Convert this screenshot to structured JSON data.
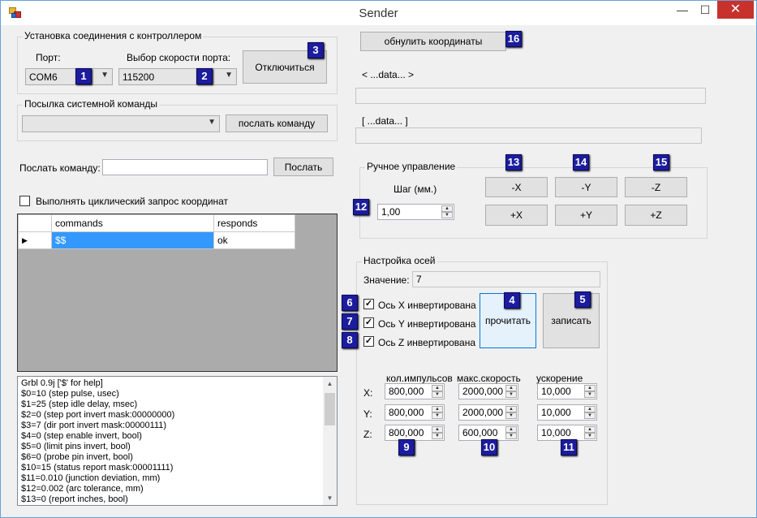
{
  "window": {
    "title": "Sender",
    "minimize": "—",
    "maximize": "☐",
    "close": "✕"
  },
  "connection": {
    "group_title": "Установка соединения с контроллером",
    "port_label": "Порт:",
    "port_value": "COM6",
    "speed_label": "Выбор скорости порта:",
    "speed_value": "115200",
    "disconnect_label": "Отключиться"
  },
  "system_command": {
    "group_title": "Посылка системной команды",
    "combo_value": "",
    "send_label": "послать команду"
  },
  "send_command": {
    "label": "Послать команду:",
    "value": "",
    "button": "Послать"
  },
  "cyclic": {
    "label": "Выполнять циклический запрос координат",
    "checked": false
  },
  "grid": {
    "headers": [
      "commands",
      "responds"
    ],
    "rows": [
      {
        "command": "$$",
        "respond": "ok"
      }
    ]
  },
  "log_lines": [
    "Grbl 0.9j ['$' for help]",
    "$0=10 (step pulse, usec)",
    "$1=25 (step idle delay, msec)",
    "$2=0 (step port invert mask:00000000)",
    "$3=7 (dir port invert mask:00000111)",
    "$4=0 (step enable invert, bool)",
    "$5=0 (limit pins invert, bool)",
    "$6=0 (probe pin invert, bool)",
    "$10=15 (status report mask:00001111)",
    "$11=0.010 (junction deviation, mm)",
    "$12=0.002 (arc tolerance, mm)",
    "$13=0 (report inches, bool)"
  ],
  "reset_coords": "обнулить координаты",
  "data_angle_label": "< ...data... >",
  "data_angle_value": "",
  "data_square_label": "[ ...data... ]",
  "data_square_value": "",
  "manual": {
    "group_title": "Ручное управление",
    "step_label": "Шаг (мм.)",
    "step_value": "1,00",
    "buttons": {
      "minus_x": "-X",
      "minus_y": "-Y",
      "minus_z": "-Z",
      "plus_x": "+X",
      "plus_y": "+Y",
      "plus_z": "+Z"
    }
  },
  "axes": {
    "group_title": "Настройка осей",
    "value_label": "Значение:",
    "value": "7",
    "invert_x": {
      "label": "Ось X инвертирована",
      "checked": true
    },
    "invert_y": {
      "label": "Ось Y инвертирована",
      "checked": true
    },
    "invert_z": {
      "label": "Ось Z инвертирована",
      "checked": true
    },
    "read_label": "прочитать",
    "write_label": "записать",
    "col_pulses": "кол.импульсов",
    "col_speed": "макс.скорость",
    "col_accel": "ускорение",
    "row_x": "X:",
    "row_y": "Y:",
    "row_z": "Z:",
    "x": {
      "pulses": "800,000",
      "speed": "2000,000",
      "accel": "10,000"
    },
    "y": {
      "pulses": "800,000",
      "speed": "2000,000",
      "accel": "10,000"
    },
    "z": {
      "pulses": "800,000",
      "speed": "600,000",
      "accel": "10,000"
    }
  },
  "badges": [
    "1",
    "2",
    "3",
    "4",
    "5",
    "6",
    "7",
    "8",
    "9",
    "10",
    "11",
    "12",
    "13",
    "14",
    "15",
    "16"
  ],
  "colors": {
    "badge_bg": "#1c1c9e",
    "selection": "#3399ff",
    "close_bg": "#c7322d"
  }
}
